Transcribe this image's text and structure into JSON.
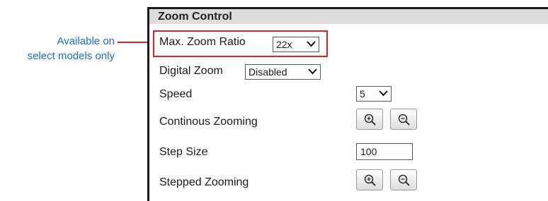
{
  "callout": {
    "line1": "Available on",
    "line2": "select models only"
  },
  "panel": {
    "title": "Zoom Control"
  },
  "max_zoom": {
    "label": "Max. Zoom Ratio",
    "value": "22x"
  },
  "digital_zoom": {
    "label": "Digital Zoom",
    "value": "Disabled"
  },
  "speed": {
    "label": "Speed",
    "value": "5"
  },
  "continuous_zooming": {
    "label": "Continous Zooming",
    "zoom_in_icon": "zoom-in-icon",
    "zoom_out_icon": "zoom-out-icon"
  },
  "step_size": {
    "label": "Step Size",
    "value": "100"
  },
  "stepped_zooming": {
    "label": "Stepped Zooming",
    "zoom_in_icon": "zoom-in-icon",
    "zoom_out_icon": "zoom-out-icon"
  },
  "colors": {
    "callout_text": "#1a6fc4",
    "highlight": "#e02020",
    "header_bg": "#dcdcdc"
  }
}
